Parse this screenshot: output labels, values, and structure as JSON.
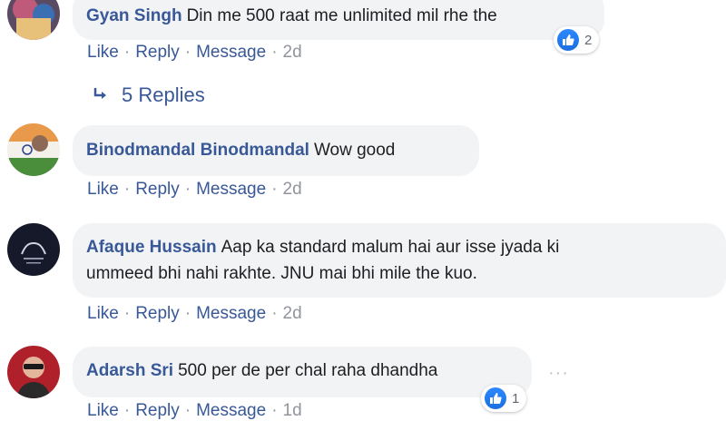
{
  "comments": [
    {
      "author": "Gyan Singh",
      "text": "Din me 500 raat me unlimited mil rhe the",
      "actions": {
        "like": "Like",
        "reply": "Reply",
        "message": "Message",
        "time": "2d"
      },
      "reaction_count": "2"
    },
    {
      "author": "Binodmandal Binodmandal",
      "text": "Wow good",
      "actions": {
        "like": "Like",
        "reply": "Reply",
        "message": "Message",
        "time": "2d"
      }
    },
    {
      "author": "Afaque Hussain",
      "text_line1": "Aap ka standard malum hai aur isse jyada ki",
      "text_line2": "ummeed bhi nahi rakhte. JNU mai bhi mile the kuo.",
      "actions": {
        "like": "Like",
        "reply": "Reply",
        "message": "Message",
        "time": "2d"
      }
    },
    {
      "author": "Adarsh Sri",
      "text": "500 per de per chal raha dhandha",
      "actions": {
        "like": "Like",
        "reply": "Reply",
        "message": "Message",
        "time": "1d"
      },
      "reaction_count": "1"
    }
  ],
  "replies_link": {
    "label": "5 Replies",
    "icon": "reply-arrow-icon"
  },
  "more_options": "···",
  "separator": "·",
  "colors": {
    "link": "#385898",
    "bubble": "#f2f3f5",
    "like": "#2d88ff",
    "muted": "#90949c"
  }
}
